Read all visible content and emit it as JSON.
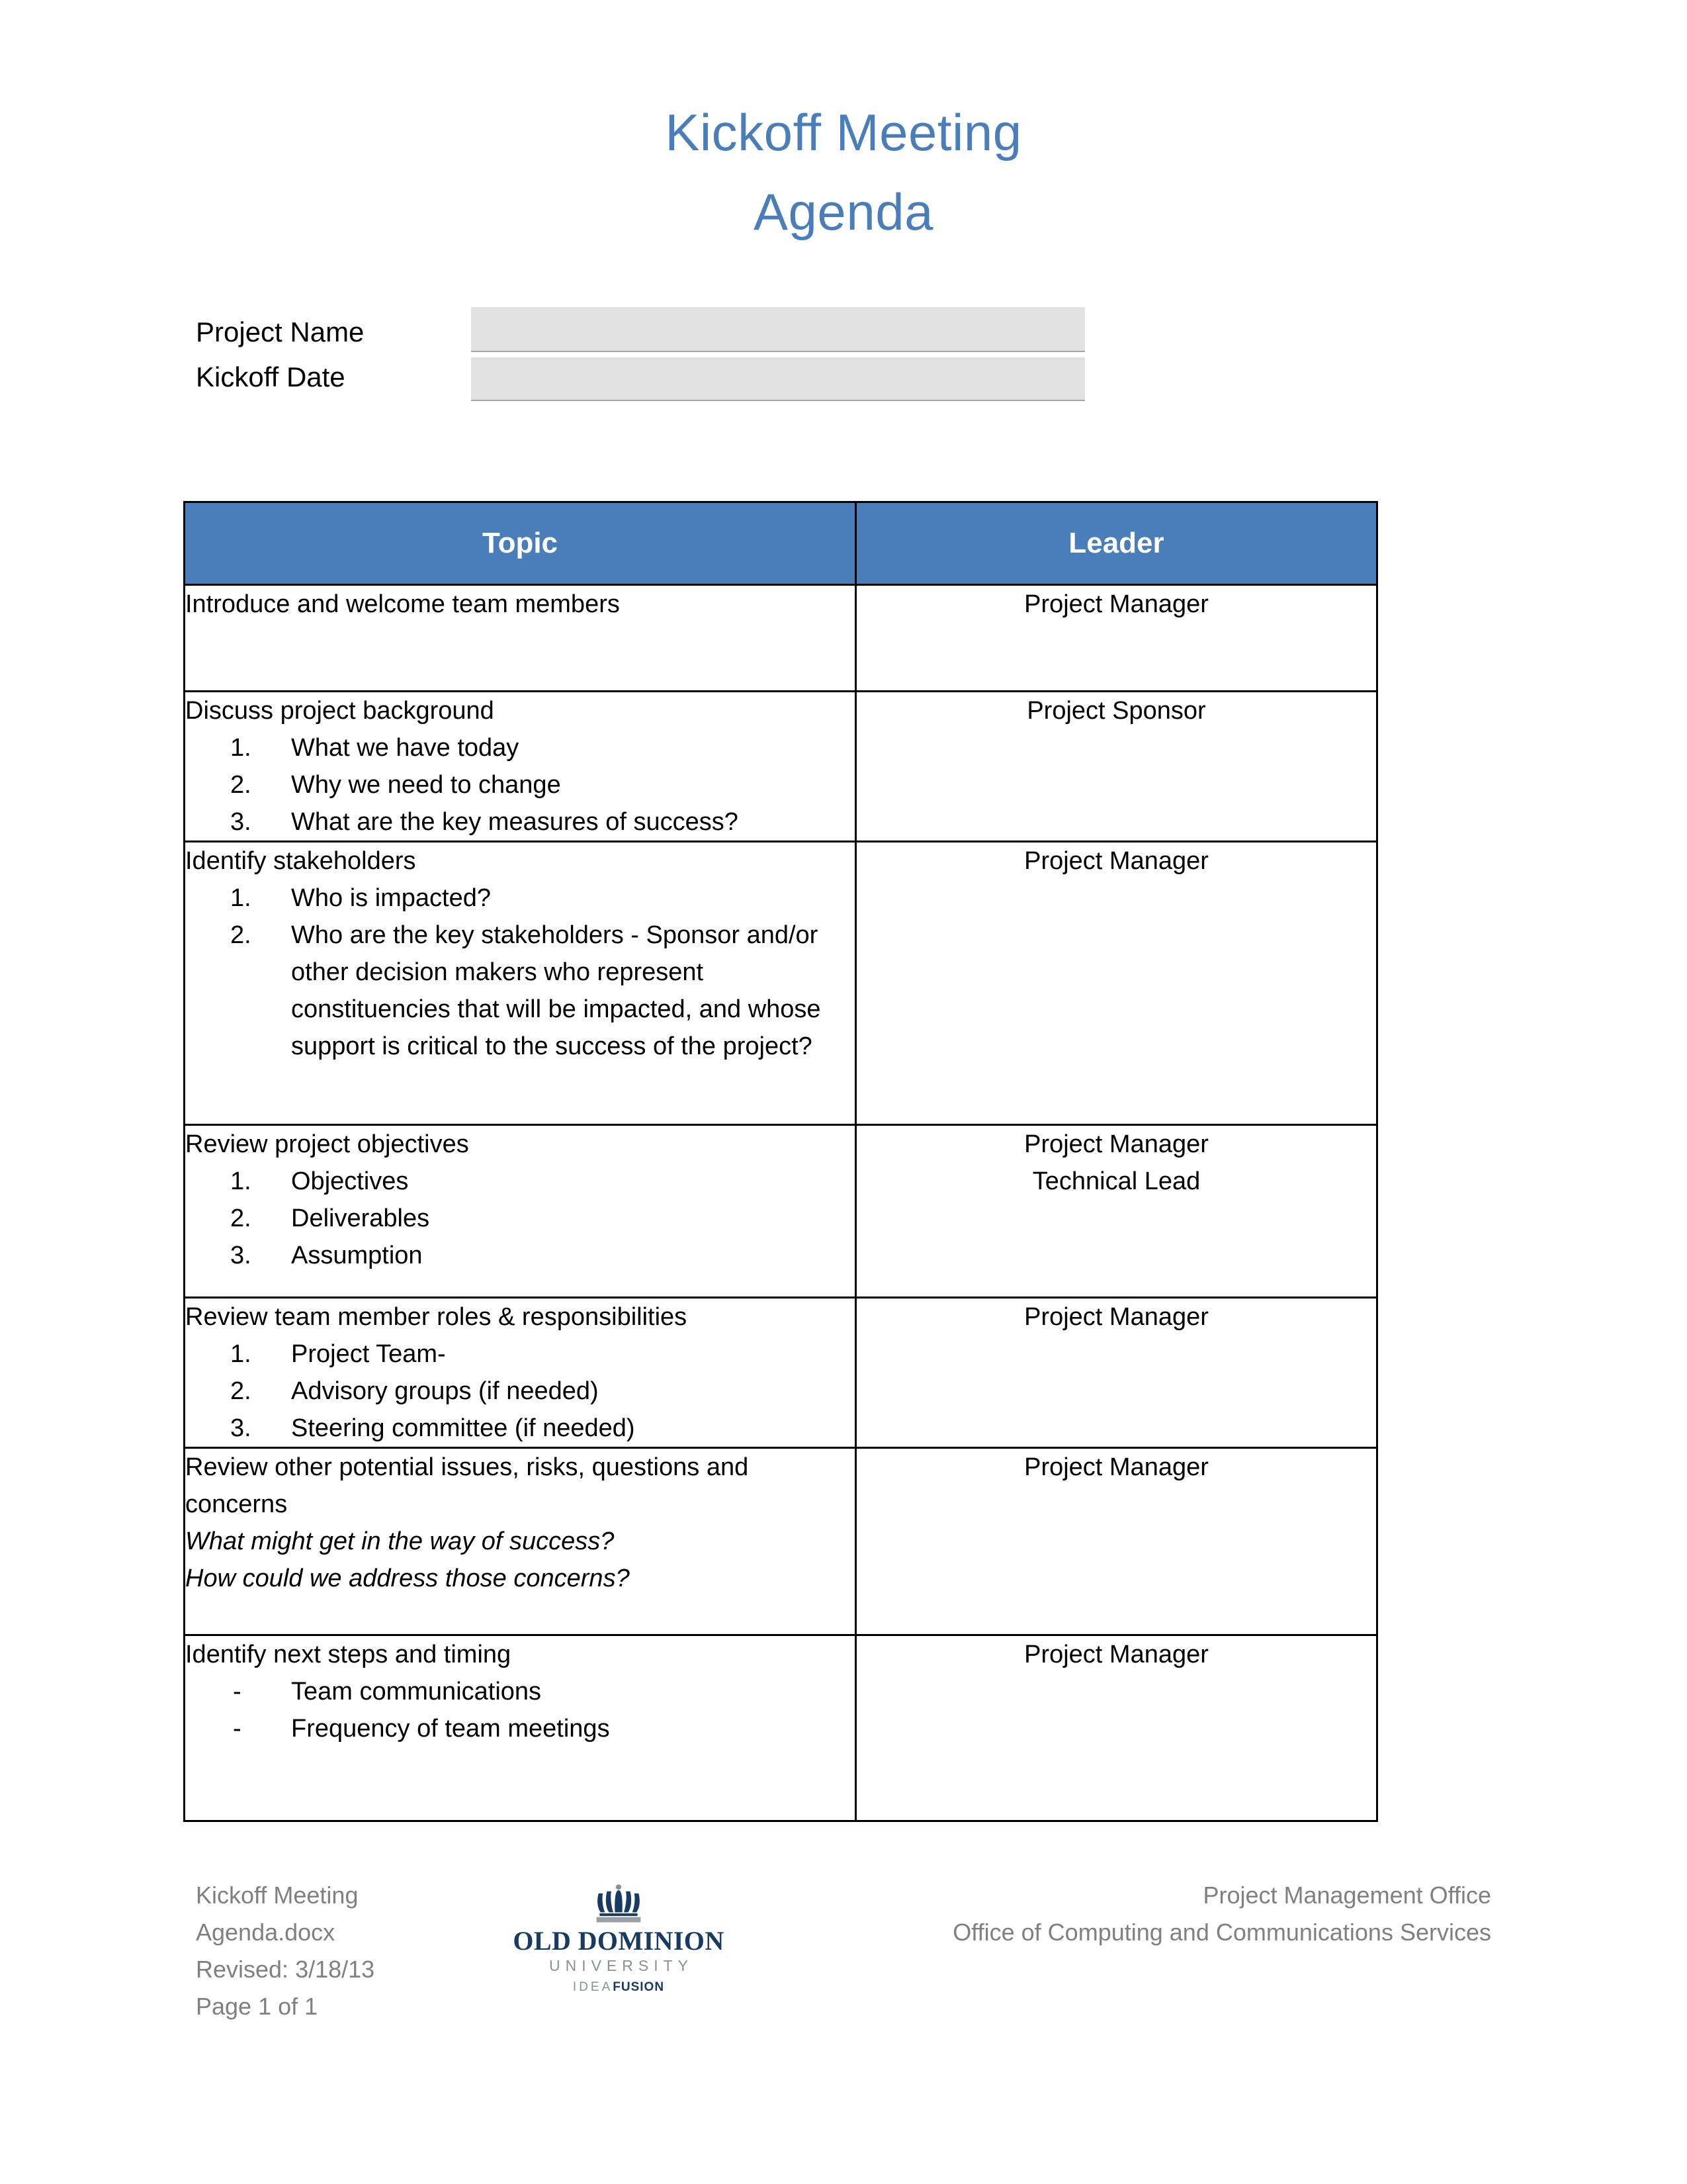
{
  "document": {
    "title_lines": [
      "Kickoff Meeting",
      "Agenda"
    ],
    "title_color": "#4A7EBB"
  },
  "form": {
    "project_name": {
      "label": "Project Name",
      "value": ""
    },
    "kickoff_date": {
      "label": "Kickoff Date",
      "value": ""
    },
    "field_fill_color": "#E1E1E1"
  },
  "table": {
    "header_bg": "#4A7EBB",
    "header_text_color": "#FFFFFF",
    "columns": [
      "Topic",
      "Leader"
    ],
    "rows": [
      {
        "topic": "Introduce and welcome team members",
        "items": [],
        "item_style": "none",
        "italics": [],
        "leaders": [
          "Project Manager"
        ]
      },
      {
        "topic": "Discuss project background",
        "items": [
          "What we have today",
          "Why we need to change",
          "What are the key measures of success?"
        ],
        "item_style": "numbered",
        "italics": [],
        "leaders": [
          "Project Sponsor"
        ]
      },
      {
        "topic": "Identify stakeholders",
        "items": [
          "Who is impacted?",
          "Who are the key stakeholders - Sponsor and/or other decision makers who represent constituencies that will be impacted, and whose support is critical to the success of the project?"
        ],
        "item_style": "numbered",
        "italics": [],
        "leaders": [
          "Project Manager"
        ]
      },
      {
        "topic": "Review project objectives",
        "items": [
          "Objectives",
          "Deliverables",
          "Assumption"
        ],
        "item_style": "numbered",
        "italics": [],
        "leaders": [
          "Project Manager",
          "Technical Lead"
        ]
      },
      {
        "topic": "Review team member roles & responsibilities",
        "items": [
          "Project Team-",
          "Advisory groups (if needed)",
          "Steering committee (if needed)"
        ],
        "item_style": "numbered",
        "italics": [],
        "leaders": [
          "Project Manager"
        ]
      },
      {
        "topic": "Review other potential issues, risks, questions and concerns",
        "items": [],
        "item_style": "none",
        "italics": [
          "What might get in the way of success?",
          "How could we address those concerns?"
        ],
        "leaders": [
          "Project Manager"
        ]
      },
      {
        "topic": "Identify next steps and timing",
        "items": [
          "Team communications",
          "Frequency of team meetings"
        ],
        "item_style": "dash",
        "italics": [],
        "leaders": [
          "Project Manager"
        ]
      }
    ]
  },
  "footer": {
    "left_lines": [
      "Kickoff Meeting",
      "Agenda.docx",
      "Revised: 3/18/13",
      "Page 1 of 1"
    ],
    "right_lines": [
      "Project Management Office",
      "Office of Computing and Communications Services"
    ],
    "text_color": "#808080",
    "logo": {
      "name": "OLD DOMINION",
      "subname": "UNIVERSITY",
      "tagline_first": "IDEA",
      "tagline_second": "FUSION",
      "navy": "#173B63",
      "gray": "#8A8F96"
    }
  }
}
